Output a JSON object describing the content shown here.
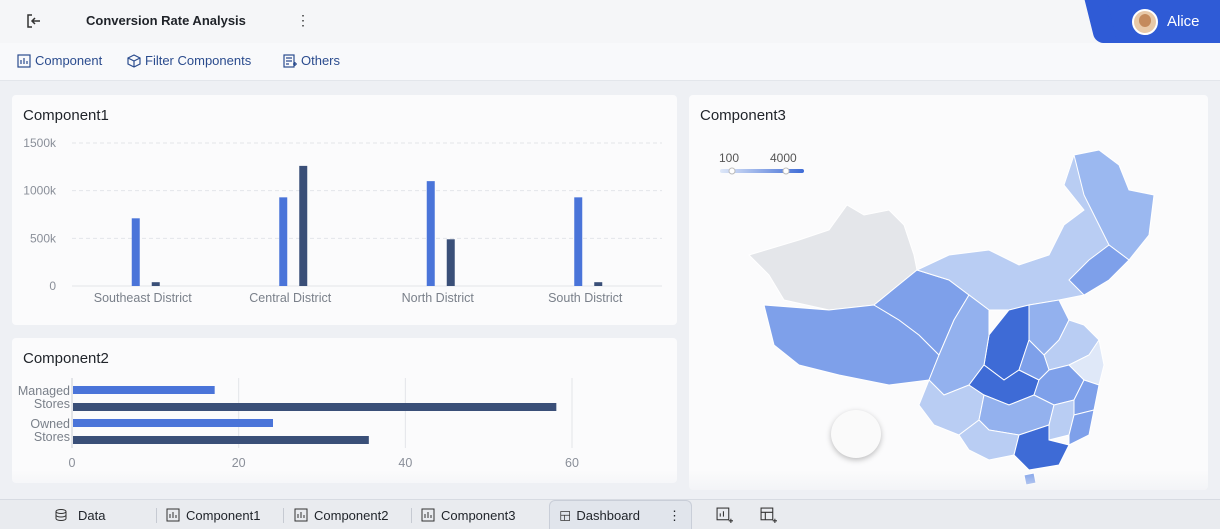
{
  "header": {
    "title": "Conversion Rate Analysis",
    "user": "Alice"
  },
  "toolbar": {
    "component": "Component",
    "filter": "Filter Components",
    "others": "Others"
  },
  "panels": {
    "p1": "Component1",
    "p2": "Component2",
    "p3": "Component3"
  },
  "tabs": {
    "data": "Data",
    "c1": "Component1",
    "c2": "Component2",
    "c3": "Component3",
    "dashboard": "Dashboard"
  },
  "chart_data": [
    {
      "type": "bar",
      "title": "Component1",
      "categories": [
        "Southeast District",
        "Central District",
        "North District",
        "South District"
      ],
      "series": [
        {
          "values": [
            710000,
            930000,
            1100000,
            930000
          ],
          "color": "#4a74d9"
        },
        {
          "values": [
            40000,
            1260000,
            490000,
            40000
          ],
          "color": "#3a4f78"
        }
      ],
      "yticks": [
        "0",
        "500k",
        "1000k",
        "1500k"
      ],
      "ylim": [
        0,
        1500000
      ]
    },
    {
      "type": "bar",
      "orientation": "horizontal",
      "title": "Component2",
      "categories": [
        "Managed Stores",
        "Owned Stores"
      ],
      "series": [
        {
          "values": [
            17,
            24
          ],
          "color": "#4a74d9"
        },
        {
          "values": [
            58,
            35.5
          ],
          "color": "#3a4f78"
        }
      ],
      "xticks": [
        "0",
        "20",
        "40",
        "60"
      ],
      "xlim": [
        0,
        60
      ]
    },
    {
      "type": "map",
      "title": "Component3",
      "legend": {
        "min": "100",
        "max": "4000"
      }
    }
  ]
}
